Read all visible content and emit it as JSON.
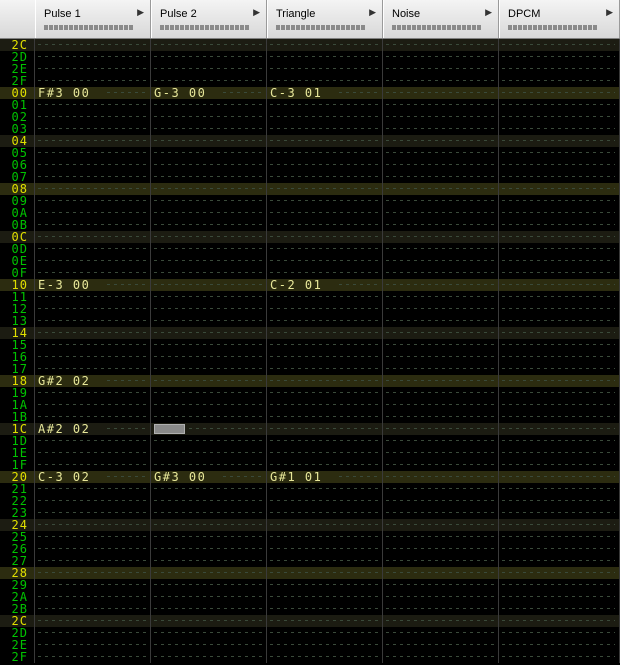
{
  "channels": [
    {
      "name": "Pulse 1"
    },
    {
      "name": "Pulse 2"
    },
    {
      "name": "Triangle"
    },
    {
      "name": "Noise"
    },
    {
      "name": "DPCM"
    }
  ],
  "colors": {
    "row_label": "#00c400",
    "row_label_highlight": "#e0e000",
    "note_text": "#e8e89a"
  },
  "cursor": {
    "row": 32,
    "channel": 1
  },
  "rows": [
    {
      "label": "2C",
      "hl": "y",
      "cells": [
        "",
        "",
        "",
        "",
        ""
      ]
    },
    {
      "label": "2D",
      "hl": "",
      "cells": [
        "",
        "",
        "",
        "",
        ""
      ]
    },
    {
      "label": "2E",
      "hl": "",
      "cells": [
        "",
        "",
        "",
        "",
        ""
      ]
    },
    {
      "label": "2F",
      "hl": "",
      "cells": [
        "",
        "",
        "",
        "",
        ""
      ]
    },
    {
      "label": "00",
      "hl": "y",
      "cells": [
        "F#3 00",
        "G-3 00",
        "C-3 01",
        "",
        ""
      ]
    },
    {
      "label": "01",
      "hl": "",
      "cells": [
        "",
        "",
        "",
        "",
        ""
      ]
    },
    {
      "label": "02",
      "hl": "",
      "cells": [
        "",
        "",
        "",
        "",
        ""
      ]
    },
    {
      "label": "03",
      "hl": "",
      "cells": [
        "",
        "",
        "",
        "",
        ""
      ]
    },
    {
      "label": "04",
      "hl": "y",
      "cells": [
        "",
        "",
        "",
        "",
        ""
      ]
    },
    {
      "label": "05",
      "hl": "",
      "cells": [
        "",
        "",
        "",
        "",
        ""
      ]
    },
    {
      "label": "06",
      "hl": "",
      "cells": [
        "",
        "",
        "",
        "",
        ""
      ]
    },
    {
      "label": "07",
      "hl": "",
      "cells": [
        "",
        "",
        "",
        "",
        ""
      ]
    },
    {
      "label": "08",
      "hl": "y",
      "cells": [
        "",
        "",
        "",
        "",
        ""
      ]
    },
    {
      "label": "09",
      "hl": "",
      "cells": [
        "",
        "",
        "",
        "",
        ""
      ]
    },
    {
      "label": "0A",
      "hl": "",
      "cells": [
        "",
        "",
        "",
        "",
        ""
      ]
    },
    {
      "label": "0B",
      "hl": "",
      "cells": [
        "",
        "",
        "",
        "",
        ""
      ]
    },
    {
      "label": "0C",
      "hl": "y",
      "cells": [
        "",
        "",
        "",
        "",
        ""
      ]
    },
    {
      "label": "0D",
      "hl": "",
      "cells": [
        "",
        "",
        "",
        "",
        ""
      ]
    },
    {
      "label": "0E",
      "hl": "",
      "cells": [
        "",
        "",
        "",
        "",
        ""
      ]
    },
    {
      "label": "0F",
      "hl": "",
      "cells": [
        "",
        "",
        "",
        "",
        ""
      ]
    },
    {
      "label": "10",
      "hl": "y",
      "cells": [
        "E-3 00",
        "",
        "C-2 01",
        "",
        ""
      ]
    },
    {
      "label": "11",
      "hl": "",
      "cells": [
        "",
        "",
        "",
        "",
        ""
      ]
    },
    {
      "label": "12",
      "hl": "",
      "cells": [
        "",
        "",
        "",
        "",
        ""
      ]
    },
    {
      "label": "13",
      "hl": "",
      "cells": [
        "",
        "",
        "",
        "",
        ""
      ]
    },
    {
      "label": "14",
      "hl": "y",
      "cells": [
        "",
        "",
        "",
        "",
        ""
      ]
    },
    {
      "label": "15",
      "hl": "",
      "cells": [
        "",
        "",
        "",
        "",
        ""
      ]
    },
    {
      "label": "16",
      "hl": "",
      "cells": [
        "",
        "",
        "",
        "",
        ""
      ]
    },
    {
      "label": "17",
      "hl": "",
      "cells": [
        "",
        "",
        "",
        "",
        ""
      ]
    },
    {
      "label": "18",
      "hl": "y",
      "cells": [
        "G#2 02",
        "",
        "",
        "",
        ""
      ]
    },
    {
      "label": "19",
      "hl": "",
      "cells": [
        "",
        "",
        "",
        "",
        ""
      ]
    },
    {
      "label": "1A",
      "hl": "",
      "cells": [
        "",
        "",
        "",
        "",
        ""
      ]
    },
    {
      "label": "1B",
      "hl": "",
      "cells": [
        "",
        "",
        "",
        "",
        ""
      ]
    },
    {
      "label": "1C",
      "hl": "y",
      "cells": [
        "A#2 02",
        "",
        "",
        "",
        ""
      ]
    },
    {
      "label": "1D",
      "hl": "",
      "cells": [
        "",
        "",
        "",
        "",
        ""
      ]
    },
    {
      "label": "1E",
      "hl": "",
      "cells": [
        "",
        "",
        "",
        "",
        ""
      ]
    },
    {
      "label": "1F",
      "hl": "",
      "cells": [
        "",
        "",
        "",
        "",
        ""
      ]
    },
    {
      "label": "20",
      "hl": "y",
      "cells": [
        "C-3 02",
        "G#3 00",
        "G#1 01",
        "",
        ""
      ]
    },
    {
      "label": "21",
      "hl": "",
      "cells": [
        "",
        "",
        "",
        "",
        ""
      ]
    },
    {
      "label": "22",
      "hl": "",
      "cells": [
        "",
        "",
        "",
        "",
        ""
      ]
    },
    {
      "label": "23",
      "hl": "",
      "cells": [
        "",
        "",
        "",
        "",
        ""
      ]
    },
    {
      "label": "24",
      "hl": "y",
      "cells": [
        "",
        "",
        "",
        "",
        ""
      ]
    },
    {
      "label": "25",
      "hl": "",
      "cells": [
        "",
        "",
        "",
        "",
        ""
      ]
    },
    {
      "label": "26",
      "hl": "",
      "cells": [
        "",
        "",
        "",
        "",
        ""
      ]
    },
    {
      "label": "27",
      "hl": "",
      "cells": [
        "",
        "",
        "",
        "",
        ""
      ]
    },
    {
      "label": "28",
      "hl": "y",
      "cells": [
        "",
        "",
        "",
        "",
        ""
      ]
    },
    {
      "label": "29",
      "hl": "",
      "cells": [
        "",
        "",
        "",
        "",
        ""
      ]
    },
    {
      "label": "2A",
      "hl": "",
      "cells": [
        "",
        "",
        "",
        "",
        ""
      ]
    },
    {
      "label": "2B",
      "hl": "",
      "cells": [
        "",
        "",
        "",
        "",
        ""
      ]
    },
    {
      "label": "2C",
      "hl": "y",
      "cells": [
        "",
        "",
        "",
        "",
        ""
      ]
    },
    {
      "label": "2D",
      "hl": "",
      "cells": [
        "",
        "",
        "",
        "",
        ""
      ]
    },
    {
      "label": "2E",
      "hl": "",
      "cells": [
        "",
        "",
        "",
        "",
        ""
      ]
    },
    {
      "label": "2F",
      "hl": "",
      "cells": [
        "",
        "",
        "",
        "",
        ""
      ]
    }
  ]
}
